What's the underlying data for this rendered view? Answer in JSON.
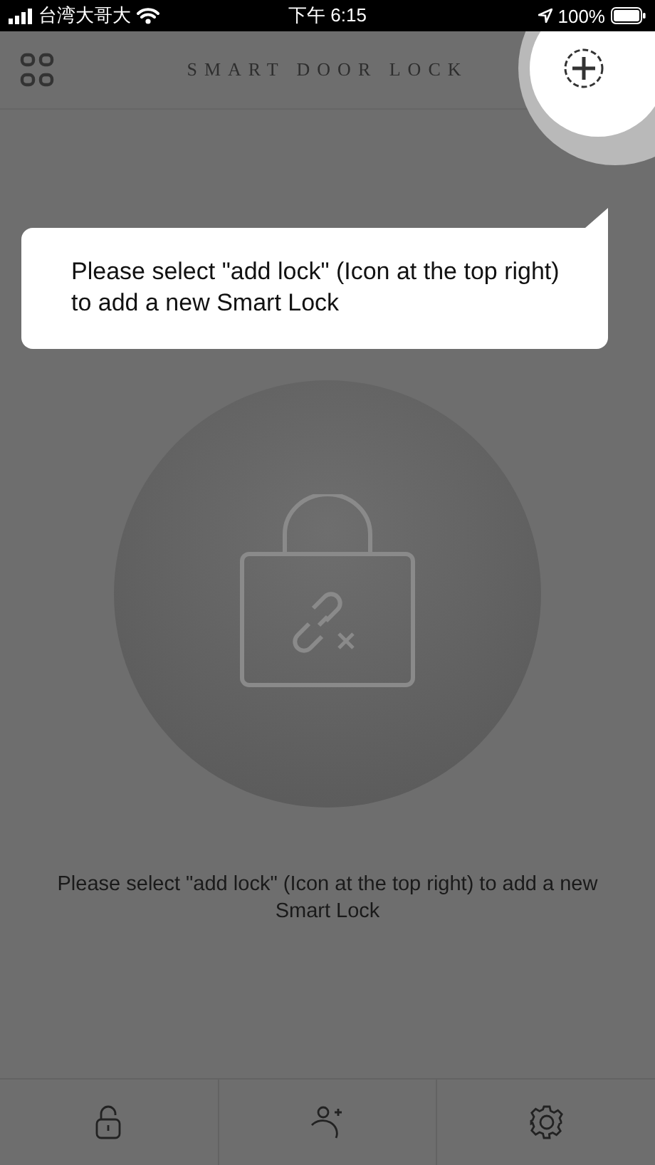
{
  "status_bar": {
    "carrier": "台湾大哥大",
    "time": "下午 6:15",
    "battery": "100%"
  },
  "header": {
    "title": "SMART DOOR LOCK"
  },
  "tooltip": {
    "text": "Please select \"add lock\" (Icon at the top right) to add a new Smart Lock"
  },
  "message": "Please select \"add lock\" (Icon at the top right) to add a new Smart Lock",
  "tab_bar": {
    "items": [
      {
        "kind": "unlock"
      },
      {
        "kind": "add-user"
      },
      {
        "kind": "settings"
      }
    ]
  }
}
